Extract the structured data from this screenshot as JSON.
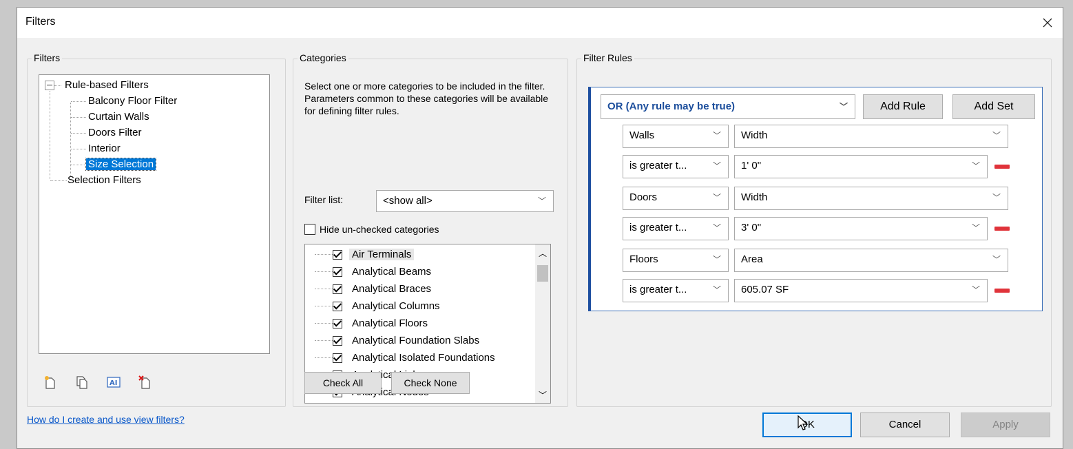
{
  "dialog": {
    "title": "Filters",
    "close_label": "×"
  },
  "filters_group": {
    "legend": "Filters",
    "tree": {
      "root": "Rule-based Filters",
      "children": [
        "Balcony Floor Filter",
        "Curtain Walls",
        "Doors Filter",
        "Interior",
        "Size Selection"
      ],
      "selected": "Size Selection",
      "other_root": "Selection Filters"
    },
    "icons": [
      "new-filter-icon",
      "duplicate-filter-icon",
      "rename-filter-icon",
      "delete-filter-icon"
    ]
  },
  "categories_group": {
    "legend": "Categories",
    "description": "Select one or more categories to be included in the filter.  Parameters common to these categories will be available for defining filter rules.",
    "filter_list_label": "Filter list:",
    "filter_list_value": "<show all>",
    "hide_unchecked_label": "Hide un-checked categories",
    "hide_unchecked_checked": false,
    "items": [
      {
        "label": "Air Terminals",
        "checked": true
      },
      {
        "label": "Analytical Beams",
        "checked": true
      },
      {
        "label": "Analytical Braces",
        "checked": true
      },
      {
        "label": "Analytical Columns",
        "checked": true
      },
      {
        "label": "Analytical Floors",
        "checked": true
      },
      {
        "label": "Analytical Foundation Slabs",
        "checked": true
      },
      {
        "label": "Analytical Isolated Foundations",
        "checked": true
      },
      {
        "label": "Analytical Links",
        "checked": true
      },
      {
        "label": "Analytical Nodes",
        "checked": true
      }
    ],
    "check_all": "Check All",
    "check_none": "Check None"
  },
  "rules_group": {
    "legend": "Filter Rules",
    "logic": "OR (Any rule may be true)",
    "add_rule": "Add Rule",
    "add_set": "Add Set",
    "rules": [
      {
        "category": "Walls",
        "parameter": "Width",
        "operator": "is greater t...",
        "value": "1'  0\""
      },
      {
        "category": "Doors",
        "parameter": "Width",
        "operator": "is greater t...",
        "value": "3'  0\""
      },
      {
        "category": "Floors",
        "parameter": "Area",
        "operator": "is greater t...",
        "value": "605.07 SF"
      }
    ]
  },
  "footer": {
    "help_link": "How do I create and use view filters?",
    "ok": "OK",
    "cancel": "Cancel",
    "apply": "Apply"
  },
  "colors": {
    "accent": "#0078d7",
    "logic_text": "#1c4e9c",
    "remove": "#e0333a"
  }
}
